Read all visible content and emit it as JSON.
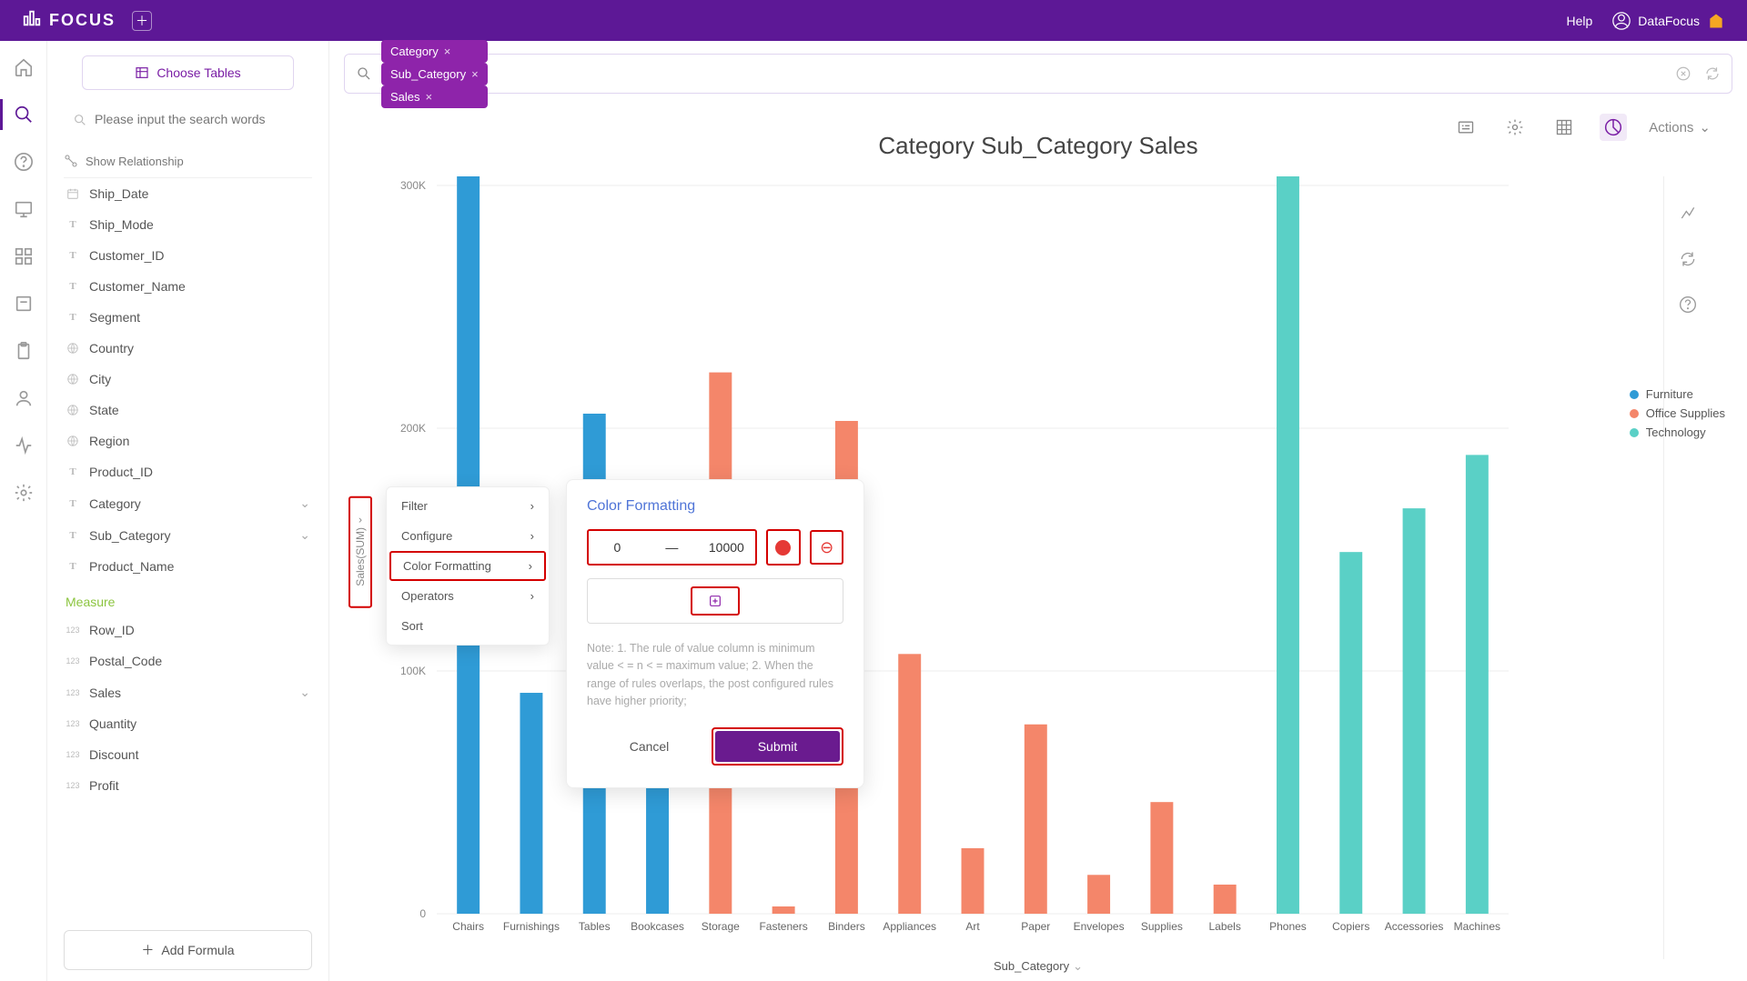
{
  "header": {
    "logo": "FOCUS",
    "help": "Help",
    "username": "DataFocus"
  },
  "panel": {
    "choose_tables": "Choose Tables",
    "search_placeholder": "Please input the search words",
    "show_relationship": "Show Relationship",
    "attributes": [
      {
        "name": "Ship_Date",
        "icon": "date"
      },
      {
        "name": "Ship_Mode",
        "icon": "T"
      },
      {
        "name": "Customer_ID",
        "icon": "T"
      },
      {
        "name": "Customer_Name",
        "icon": "T"
      },
      {
        "name": "Segment",
        "icon": "T"
      },
      {
        "name": "Country",
        "icon": "geo"
      },
      {
        "name": "City",
        "icon": "geo"
      },
      {
        "name": "State",
        "icon": "geo"
      },
      {
        "name": "Region",
        "icon": "geo"
      },
      {
        "name": "Product_ID",
        "icon": "T"
      },
      {
        "name": "Category",
        "icon": "T",
        "chev": true
      },
      {
        "name": "Sub_Category",
        "icon": "T",
        "chev": true
      },
      {
        "name": "Product_Name",
        "icon": "T"
      }
    ],
    "measure_label": "Measure",
    "measures": [
      {
        "name": "Row_ID",
        "icon": "123"
      },
      {
        "name": "Postal_Code",
        "icon": "123"
      },
      {
        "name": "Sales",
        "icon": "123",
        "chev": true
      },
      {
        "name": "Quantity",
        "icon": "123"
      },
      {
        "name": "Discount",
        "icon": "123"
      },
      {
        "name": "Profit",
        "icon": "123"
      }
    ],
    "add_formula": "Add Formula"
  },
  "search": {
    "chips": [
      "Category",
      "Sub_Category",
      "Sales"
    ]
  },
  "toolbar": {
    "actions": "Actions"
  },
  "chart": {
    "title": "Category Sub_Category Sales",
    "x_label": "Sub_Category",
    "yaxis_handle": "Sales(SUM)"
  },
  "legend": {
    "items": [
      {
        "label": "Furniture",
        "color": "#2f9bd6"
      },
      {
        "label": "Office Supplies",
        "color": "#f4866a"
      },
      {
        "label": "Technology",
        "color": "#5ad0c6"
      }
    ]
  },
  "context_menu": {
    "items": [
      "Filter",
      "Configure",
      "Color Formatting",
      "Operators",
      "Sort"
    ],
    "highlighted": "Color Formatting"
  },
  "color_formatting": {
    "title": "Color Formatting",
    "min": "0",
    "dash": "—",
    "max": "10000",
    "swatch": "#e53935",
    "add_icon": "+",
    "remove_icon": "⊖",
    "note": "Note: 1. The rule of value column is minimum value < = n < = maximum value; 2. When the range of rules overlaps, the post configured rules have higher priority;",
    "cancel": "Cancel",
    "submit": "Submit"
  },
  "chart_data": {
    "type": "bar",
    "title": "Category Sub_Category Sales",
    "xlabel": "Sub_Category",
    "ylabel": "Sales(SUM)",
    "ylim": [
      0,
      300000
    ],
    "yticks": [
      0,
      100000,
      200000,
      300000
    ],
    "ytick_labels": [
      "0",
      "100K",
      "200K",
      "300K"
    ],
    "categories": [
      "Chairs",
      "Furnishings",
      "Tables",
      "Bookcases",
      "Storage",
      "Fasteners",
      "Binders",
      "Appliances",
      "Art",
      "Paper",
      "Envelopes",
      "Supplies",
      "Labels",
      "Phones",
      "Copiers",
      "Accessories",
      "Machines"
    ],
    "series": [
      {
        "name": "Furniture",
        "color": "#2f9bd6",
        "values": [
          328000,
          91000,
          206000,
          115000,
          null,
          null,
          null,
          null,
          null,
          null,
          null,
          null,
          null,
          null,
          null,
          null,
          null
        ]
      },
      {
        "name": "Office Supplies",
        "color": "#f4866a",
        "values": [
          null,
          null,
          null,
          null,
          223000,
          3000,
          203000,
          107000,
          27000,
          78000,
          16000,
          46000,
          12000,
          null,
          null,
          null,
          null
        ]
      },
      {
        "name": "Technology",
        "color": "#5ad0c6",
        "values": [
          null,
          null,
          null,
          null,
          null,
          null,
          null,
          null,
          null,
          null,
          null,
          null,
          null,
          330000,
          149000,
          167000,
          189000
        ]
      }
    ]
  }
}
